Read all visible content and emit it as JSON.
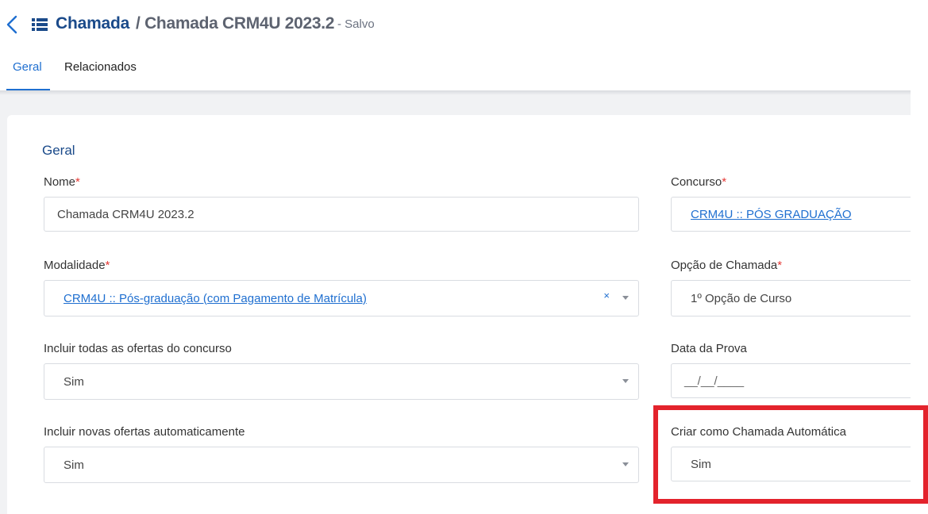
{
  "header": {
    "title": "Chamada",
    "subtitle": "/ Chamada CRM4U 2023.2",
    "status": "- Salvo"
  },
  "tabs": [
    {
      "label": "Geral",
      "active": true
    },
    {
      "label": "Relacionados",
      "active": false
    }
  ],
  "section": {
    "title": "Geral"
  },
  "fields": {
    "nome": {
      "label": "Nome",
      "required": "*",
      "value": "Chamada CRM4U 2023.2"
    },
    "concurso": {
      "label": "Concurso",
      "required": "*",
      "value": "CRM4U :: PÓS GRADUAÇÃO"
    },
    "modalidade": {
      "label": "Modalidade",
      "required": "*",
      "value": "CRM4U :: Pós-graduação (com Pagamento de Matrícula)",
      "clear": "×"
    },
    "opcao_chamada": {
      "label": "Opção de Chamada",
      "required": "*",
      "value": "1º Opção de Curso"
    },
    "incluir_todas": {
      "label": "Incluir todas as ofertas do concurso",
      "value": "Sim"
    },
    "data_prova": {
      "label": "Data da Prova",
      "placeholder": "__/__/____"
    },
    "incluir_novas": {
      "label": "Incluir novas ofertas automaticamente",
      "value": "Sim"
    },
    "criar_automatica": {
      "label": "Criar como Chamada Automática",
      "value": "Sim"
    }
  },
  "colors": {
    "accent": "#1f6fd0",
    "title": "#1a4a8a",
    "required": "#e53935",
    "highlight": "#e3232c"
  }
}
